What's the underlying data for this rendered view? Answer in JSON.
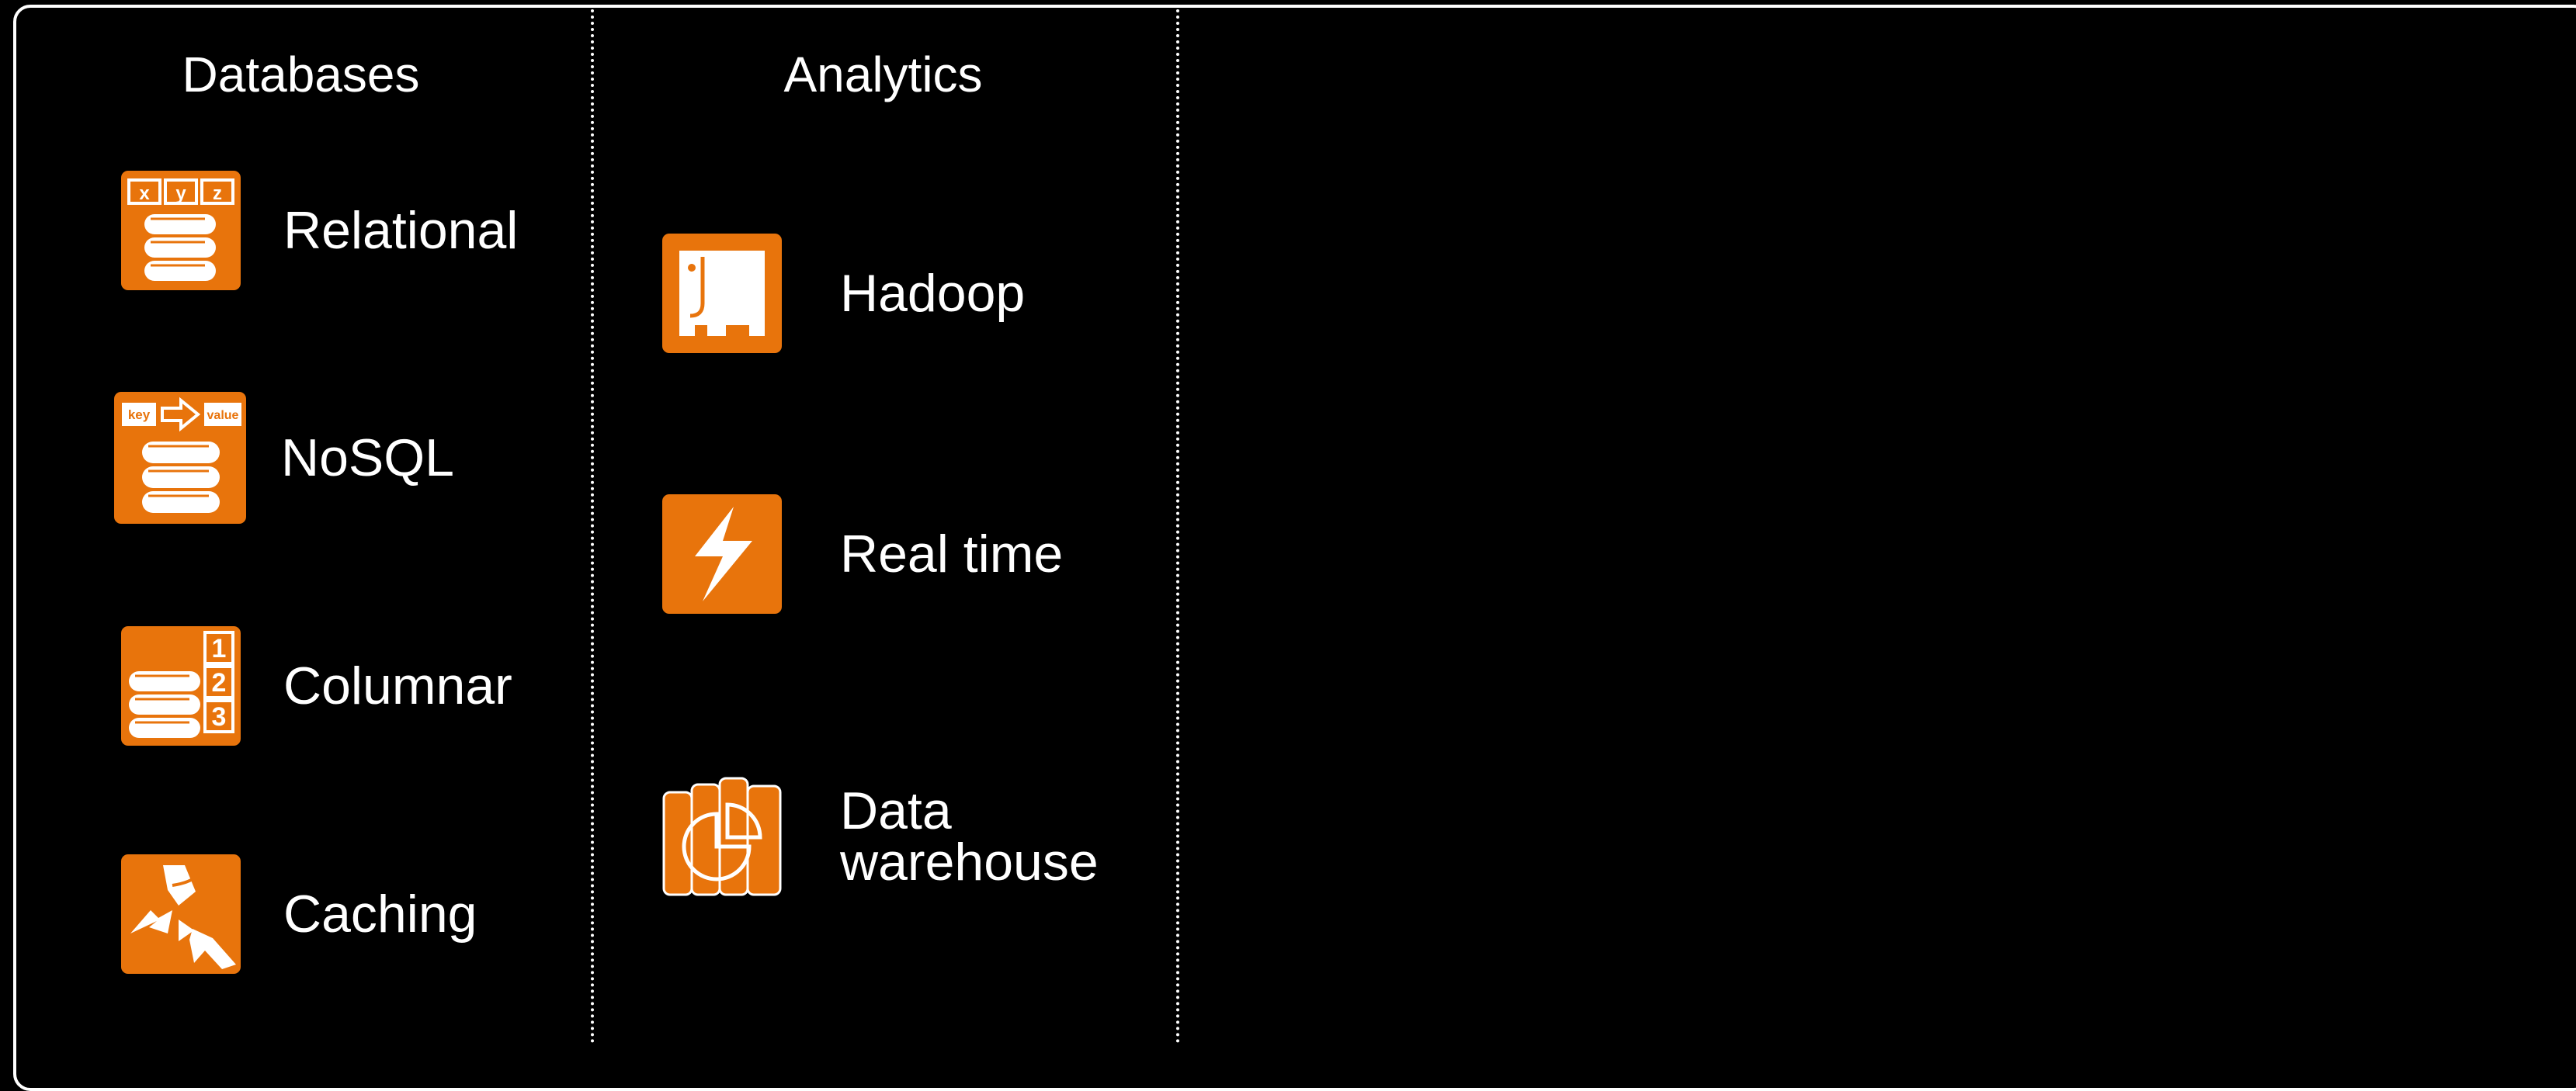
{
  "columns": [
    {
      "title": "Databases",
      "items": [
        {
          "label": "Relational",
          "icon": "relational-database-icon"
        },
        {
          "label": "NoSQL",
          "icon": "nosql-key-value-icon"
        },
        {
          "label": "Columnar",
          "icon": "columnar-database-icon"
        },
        {
          "label": "Caching",
          "icon": "caching-icon"
        }
      ]
    },
    {
      "title": "Analytics",
      "items": [
        {
          "label": "Hadoop",
          "icon": "hadoop-elephant-icon"
        },
        {
          "label": "Real time",
          "icon": "lightning-bolt-icon"
        },
        {
          "label_lines": [
            "Data",
            "warehouse"
          ],
          "icon": "data-warehouse-icon"
        }
      ]
    }
  ],
  "icon_glyphs": {
    "relational": [
      "x",
      "y",
      "z"
    ],
    "nosql": [
      "key",
      "value"
    ],
    "columnar": [
      "1",
      "2",
      "3"
    ]
  },
  "colors": {
    "background": "#000000",
    "foreground": "#ffffff",
    "accent": "#e8740c"
  }
}
